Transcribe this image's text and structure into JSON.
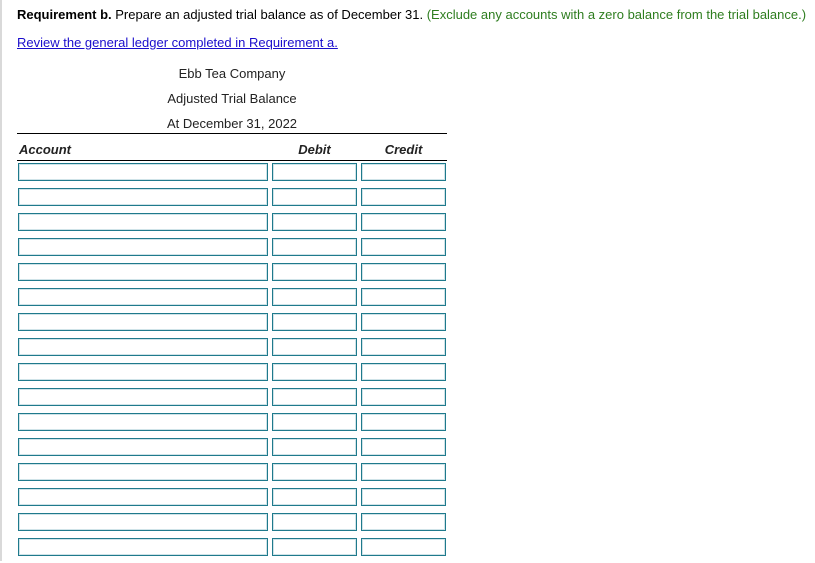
{
  "requirement": {
    "label": "Requirement b.",
    "text": " Prepare an adjusted trial balance as of December 31. ",
    "note": "(Exclude any accounts with a zero balance from the trial balance.)"
  },
  "review_link": "Review the general ledger completed in Requirement a.",
  "statement": {
    "company": "Ebb Tea Company",
    "title": "Adjusted Trial Balance",
    "date": "At December 31, 2022"
  },
  "table": {
    "headers": {
      "account": "Account",
      "debit": "Debit",
      "credit": "Credit"
    },
    "rows": [
      {
        "account": "",
        "debit": "",
        "credit": ""
      },
      {
        "account": "",
        "debit": "",
        "credit": ""
      },
      {
        "account": "",
        "debit": "",
        "credit": ""
      },
      {
        "account": "",
        "debit": "",
        "credit": ""
      },
      {
        "account": "",
        "debit": "",
        "credit": ""
      },
      {
        "account": "",
        "debit": "",
        "credit": ""
      },
      {
        "account": "",
        "debit": "",
        "credit": ""
      },
      {
        "account": "",
        "debit": "",
        "credit": ""
      },
      {
        "account": "",
        "debit": "",
        "credit": ""
      },
      {
        "account": "",
        "debit": "",
        "credit": ""
      },
      {
        "account": "",
        "debit": "",
        "credit": ""
      },
      {
        "account": "",
        "debit": "",
        "credit": ""
      },
      {
        "account": "",
        "debit": "",
        "credit": ""
      },
      {
        "account": "",
        "debit": "",
        "credit": ""
      },
      {
        "account": "",
        "debit": "",
        "credit": ""
      },
      {
        "account": "",
        "debit": "",
        "credit": ""
      }
    ]
  },
  "colors": {
    "note": "#2e7d1f",
    "link": "#1a0dcc",
    "input_border": "#1f7a8c"
  }
}
